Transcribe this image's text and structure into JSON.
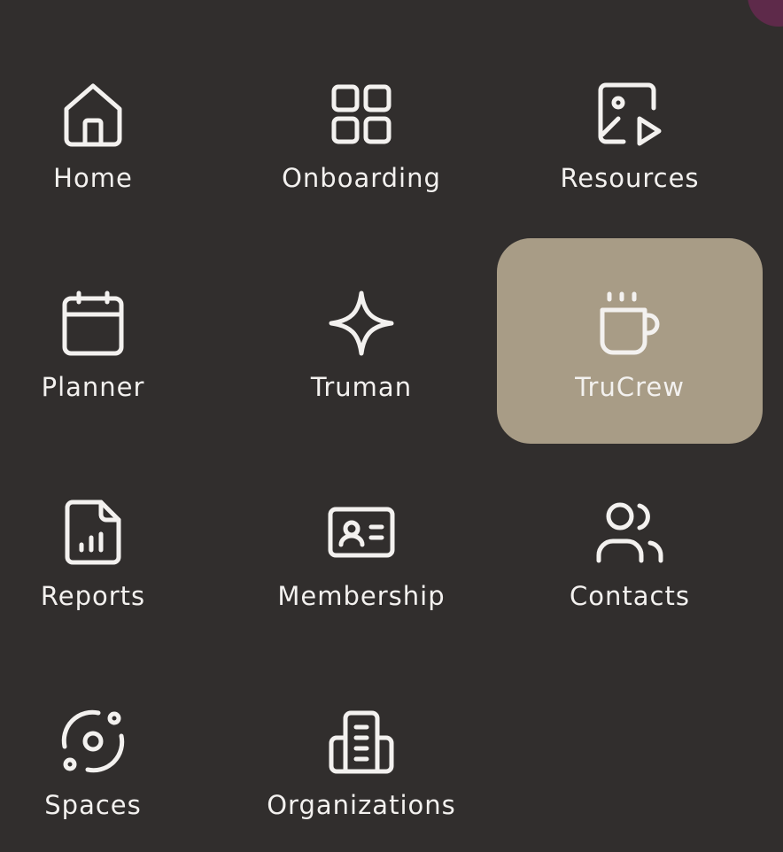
{
  "menu": {
    "items": [
      {
        "label": "Home",
        "icon": "home-icon"
      },
      {
        "label": "Onboarding",
        "icon": "grid-icon"
      },
      {
        "label": "Resources",
        "icon": "media-icon"
      },
      {
        "label": "Planner",
        "icon": "calendar-icon"
      },
      {
        "label": "Truman",
        "icon": "sparkle-icon"
      },
      {
        "label": "TruCrew",
        "icon": "coffee-icon",
        "active": true
      },
      {
        "label": "Reports",
        "icon": "report-icon"
      },
      {
        "label": "Membership",
        "icon": "id-card-icon"
      },
      {
        "label": "Contacts",
        "icon": "contacts-icon"
      },
      {
        "label": "Spaces",
        "icon": "orbit-icon"
      },
      {
        "label": "Organizations",
        "icon": "building-icon"
      }
    ]
  },
  "colors": {
    "background": "#312e2d",
    "active_tile": "#a89c86",
    "foreground": "#f3f1ef",
    "accent": "#5e2a4a"
  }
}
